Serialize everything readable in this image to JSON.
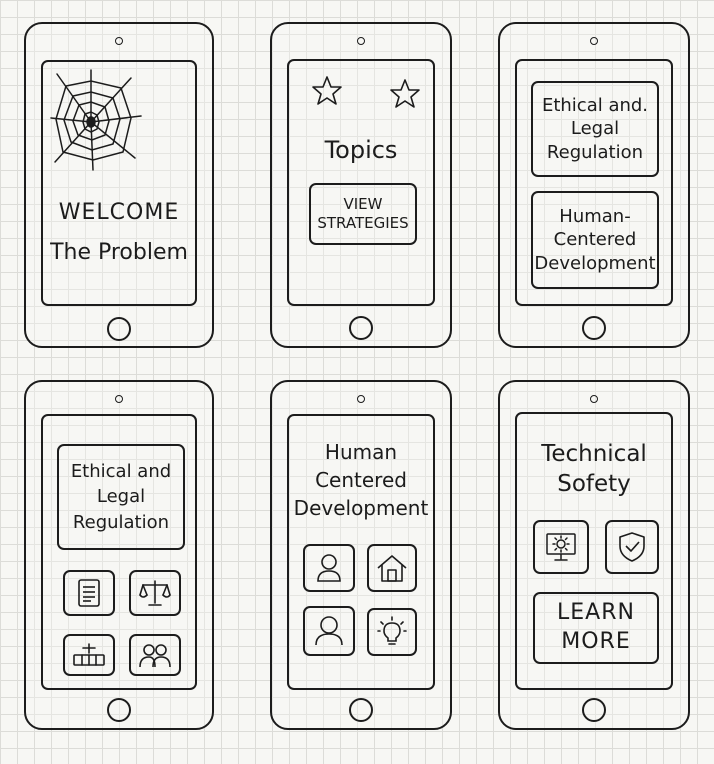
{
  "screens": {
    "s1": {
      "title": "WELCOME",
      "subtitle": "The Problem",
      "icon": "spider-web-icon"
    },
    "s2": {
      "title": "Topics",
      "button": "VIEW\nSTRATEGIES",
      "icons": [
        "star-icon",
        "star-icon"
      ]
    },
    "s3": {
      "card1": "Ethical and.\nLegal\nRegulation",
      "card2": "Human-\nCentered\nDevelopment"
    },
    "s4": {
      "card": "Ethical and\nLegal\nRegulation",
      "icons": [
        "document-icon",
        "scales-icon",
        "gavel-icon",
        "people-icon"
      ]
    },
    "s5": {
      "title": "Human\nCentered\nDevelopment",
      "icons": [
        "user-icon",
        "home-icon",
        "user-outline-icon",
        "lightbulb-icon"
      ]
    },
    "s6": {
      "title": "Technical\nSofety",
      "button": "LEARN\nMORE",
      "icons": [
        "monitor-gear-icon",
        "shield-check-icon"
      ]
    }
  },
  "colors": {
    "ink": "#1c1c1c",
    "paper": "#f7f7f4",
    "grid": "#dcdcd8"
  }
}
